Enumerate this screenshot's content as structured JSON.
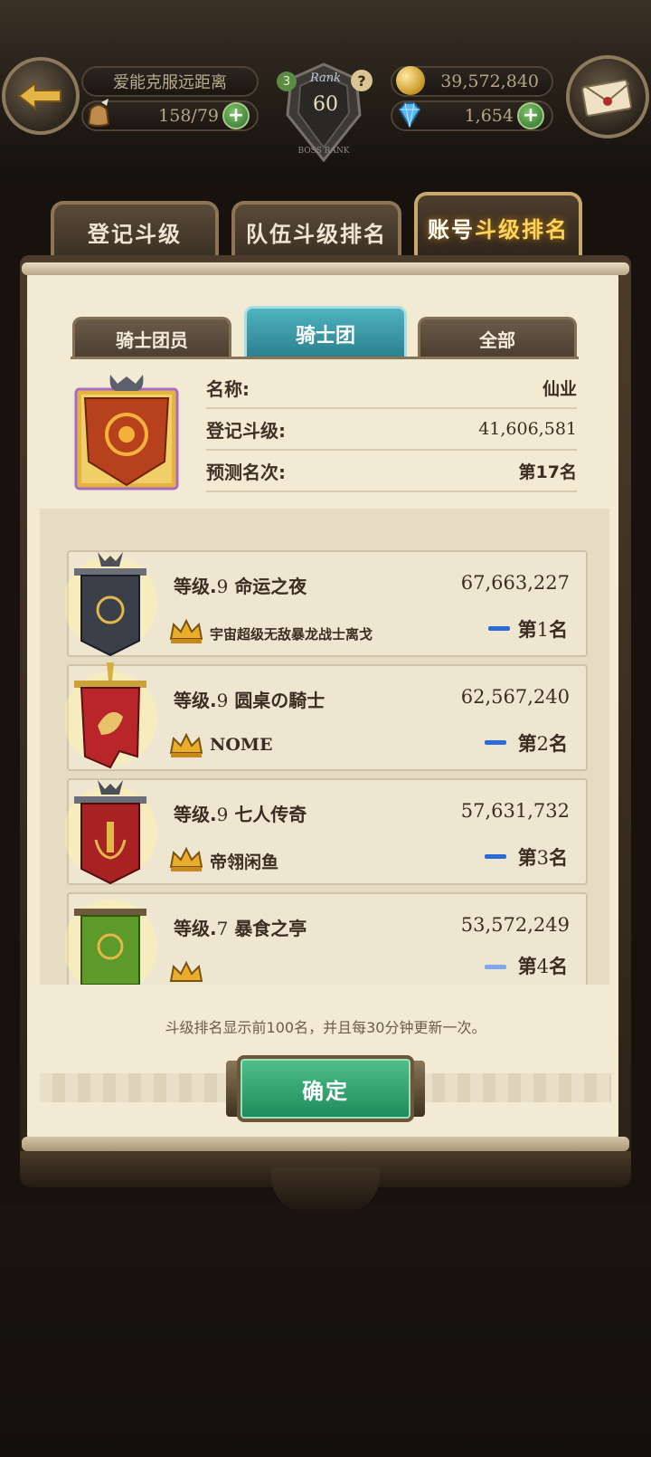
{
  "header": {
    "player_name": "爱能克服远距离",
    "stamina": "158/79",
    "rank_word": "Rank",
    "rank_level": "60",
    "gold": "39,572,840",
    "gems": "1,654",
    "badge": "3",
    "help": "?"
  },
  "main_tabs": [
    {
      "label": "登记斗级"
    },
    {
      "label": "队伍斗级排名"
    },
    {
      "label_a": "账号",
      "label_b": "斗级排名"
    }
  ],
  "sub_tabs": [
    {
      "label": "骑士团员"
    },
    {
      "label": "骑士团"
    },
    {
      "label": "全部"
    }
  ],
  "guild_info": {
    "name_label": "名称:",
    "name_value": "仙业",
    "level_label": "登记斗级:",
    "level_value": "41,606,581",
    "rank_label": "预测名次:",
    "rank_value": "第17名"
  },
  "rankings": [
    {
      "level_prefix": "等级.",
      "level": "9",
      "guild": "命运之夜",
      "score": "67,663,227",
      "leader": "宇宙超级无敌暴龙战士离戈",
      "rank_prefix": "第",
      "rank": "1",
      "rank_suffix": "名",
      "color": "#3b3f4a"
    },
    {
      "level_prefix": "等级.",
      "level": "9",
      "guild": "圆桌の騎士",
      "score": "62,567,240",
      "leader": "NOME",
      "rank_prefix": "第",
      "rank": "2",
      "rank_suffix": "名",
      "color": "#b8262a"
    },
    {
      "level_prefix": "等级.",
      "level": "9",
      "guild": "七人传奇",
      "score": "57,631,732",
      "leader": "帝翎闲鱼",
      "rank_prefix": "第",
      "rank": "3",
      "rank_suffix": "名",
      "color": "#a82223"
    },
    {
      "level_prefix": "等级.",
      "level": "7",
      "guild": "暴食之亭",
      "score": "53,572,249",
      "leader": "",
      "rank_prefix": "第",
      "rank": "4",
      "rank_suffix": "名",
      "color": "#5e9a2a"
    }
  ],
  "note": "斗级排名显示前100名，并且每30分钟更新一次。",
  "confirm_label": "确定"
}
